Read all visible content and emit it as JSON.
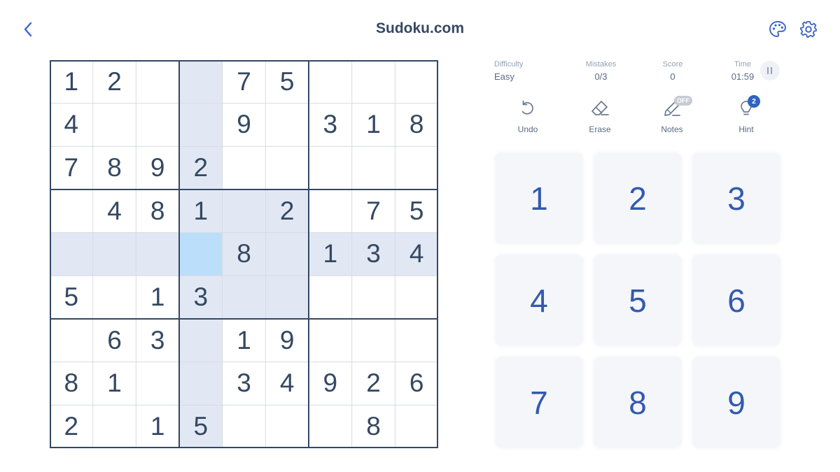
{
  "header": {
    "title": "Sudoku.com"
  },
  "icons": {
    "back": "chevron-left-icon",
    "theme": "palette-icon",
    "settings": "gear-icon"
  },
  "stats": {
    "difficulty_label": "Difficulty",
    "difficulty_value": "Easy",
    "mistakes_label": "Mistakes",
    "mistakes_value": "0/3",
    "score_label": "Score",
    "score_value": "0",
    "time_label": "Time",
    "time_value": "01:59"
  },
  "tools": {
    "undo_label": "Undo",
    "erase_label": "Erase",
    "notes_label": "Notes",
    "notes_badge": "OFF",
    "hint_label": "Hint",
    "hint_badge": "2"
  },
  "board": {
    "selected": [
      4,
      3
    ],
    "rows": [
      [
        "1",
        "2",
        "",
        "",
        "7",
        "5",
        "",
        "",
        ""
      ],
      [
        "4",
        "",
        "",
        "",
        "9",
        "",
        "3",
        "1",
        "8"
      ],
      [
        "7",
        "8",
        "9",
        "2",
        "",
        "",
        "",
        "",
        ""
      ],
      [
        "",
        "4",
        "8",
        "1",
        "",
        "2",
        "",
        "7",
        "5"
      ],
      [
        "",
        "",
        "",
        "",
        "8",
        "",
        "1",
        "3",
        "4"
      ],
      [
        "5",
        "",
        "1",
        "3",
        "",
        "",
        "",
        "",
        ""
      ],
      [
        "",
        "6",
        "3",
        "",
        "1",
        "9",
        "",
        "",
        ""
      ],
      [
        "8",
        "1",
        "",
        "",
        "3",
        "4",
        "9",
        "2",
        "6"
      ],
      [
        "2",
        "",
        "1",
        "5",
        "",
        "",
        "",
        "8",
        ""
      ]
    ]
  },
  "numpad": [
    "1",
    "2",
    "3",
    "4",
    "5",
    "6",
    "7",
    "8",
    "9"
  ],
  "colors": {
    "accent": "#325aaf",
    "text": "#344861",
    "highlight": "#e2e8f3",
    "selected": "#bbdefb",
    "numpad_bg": "#f4f6fa"
  }
}
